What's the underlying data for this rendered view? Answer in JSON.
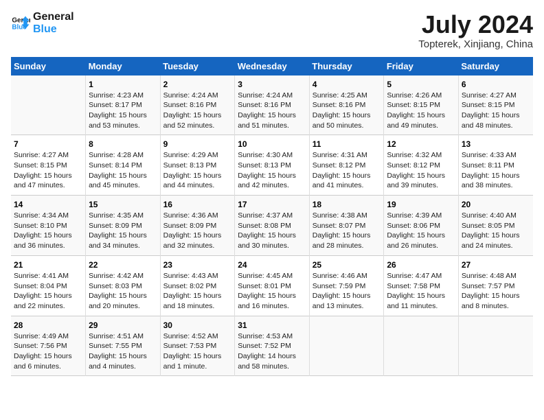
{
  "header": {
    "logo_line1": "General",
    "logo_line2": "Blue",
    "month_year": "July 2024",
    "location": "Topterek, Xinjiang, China"
  },
  "days_of_week": [
    "Sunday",
    "Monday",
    "Tuesday",
    "Wednesday",
    "Thursday",
    "Friday",
    "Saturday"
  ],
  "weeks": [
    [
      {
        "day": "",
        "text": ""
      },
      {
        "day": "1",
        "text": "Sunrise: 4:23 AM\nSunset: 8:17 PM\nDaylight: 15 hours\nand 53 minutes."
      },
      {
        "day": "2",
        "text": "Sunrise: 4:24 AM\nSunset: 8:16 PM\nDaylight: 15 hours\nand 52 minutes."
      },
      {
        "day": "3",
        "text": "Sunrise: 4:24 AM\nSunset: 8:16 PM\nDaylight: 15 hours\nand 51 minutes."
      },
      {
        "day": "4",
        "text": "Sunrise: 4:25 AM\nSunset: 8:16 PM\nDaylight: 15 hours\nand 50 minutes."
      },
      {
        "day": "5",
        "text": "Sunrise: 4:26 AM\nSunset: 8:15 PM\nDaylight: 15 hours\nand 49 minutes."
      },
      {
        "day": "6",
        "text": "Sunrise: 4:27 AM\nSunset: 8:15 PM\nDaylight: 15 hours\nand 48 minutes."
      }
    ],
    [
      {
        "day": "7",
        "text": "Sunrise: 4:27 AM\nSunset: 8:15 PM\nDaylight: 15 hours\nand 47 minutes."
      },
      {
        "day": "8",
        "text": "Sunrise: 4:28 AM\nSunset: 8:14 PM\nDaylight: 15 hours\nand 45 minutes."
      },
      {
        "day": "9",
        "text": "Sunrise: 4:29 AM\nSunset: 8:13 PM\nDaylight: 15 hours\nand 44 minutes."
      },
      {
        "day": "10",
        "text": "Sunrise: 4:30 AM\nSunset: 8:13 PM\nDaylight: 15 hours\nand 42 minutes."
      },
      {
        "day": "11",
        "text": "Sunrise: 4:31 AM\nSunset: 8:12 PM\nDaylight: 15 hours\nand 41 minutes."
      },
      {
        "day": "12",
        "text": "Sunrise: 4:32 AM\nSunset: 8:12 PM\nDaylight: 15 hours\nand 39 minutes."
      },
      {
        "day": "13",
        "text": "Sunrise: 4:33 AM\nSunset: 8:11 PM\nDaylight: 15 hours\nand 38 minutes."
      }
    ],
    [
      {
        "day": "14",
        "text": "Sunrise: 4:34 AM\nSunset: 8:10 PM\nDaylight: 15 hours\nand 36 minutes."
      },
      {
        "day": "15",
        "text": "Sunrise: 4:35 AM\nSunset: 8:09 PM\nDaylight: 15 hours\nand 34 minutes."
      },
      {
        "day": "16",
        "text": "Sunrise: 4:36 AM\nSunset: 8:09 PM\nDaylight: 15 hours\nand 32 minutes."
      },
      {
        "day": "17",
        "text": "Sunrise: 4:37 AM\nSunset: 8:08 PM\nDaylight: 15 hours\nand 30 minutes."
      },
      {
        "day": "18",
        "text": "Sunrise: 4:38 AM\nSunset: 8:07 PM\nDaylight: 15 hours\nand 28 minutes."
      },
      {
        "day": "19",
        "text": "Sunrise: 4:39 AM\nSunset: 8:06 PM\nDaylight: 15 hours\nand 26 minutes."
      },
      {
        "day": "20",
        "text": "Sunrise: 4:40 AM\nSunset: 8:05 PM\nDaylight: 15 hours\nand 24 minutes."
      }
    ],
    [
      {
        "day": "21",
        "text": "Sunrise: 4:41 AM\nSunset: 8:04 PM\nDaylight: 15 hours\nand 22 minutes."
      },
      {
        "day": "22",
        "text": "Sunrise: 4:42 AM\nSunset: 8:03 PM\nDaylight: 15 hours\nand 20 minutes."
      },
      {
        "day": "23",
        "text": "Sunrise: 4:43 AM\nSunset: 8:02 PM\nDaylight: 15 hours\nand 18 minutes."
      },
      {
        "day": "24",
        "text": "Sunrise: 4:45 AM\nSunset: 8:01 PM\nDaylight: 15 hours\nand 16 minutes."
      },
      {
        "day": "25",
        "text": "Sunrise: 4:46 AM\nSunset: 7:59 PM\nDaylight: 15 hours\nand 13 minutes."
      },
      {
        "day": "26",
        "text": "Sunrise: 4:47 AM\nSunset: 7:58 PM\nDaylight: 15 hours\nand 11 minutes."
      },
      {
        "day": "27",
        "text": "Sunrise: 4:48 AM\nSunset: 7:57 PM\nDaylight: 15 hours\nand 8 minutes."
      }
    ],
    [
      {
        "day": "28",
        "text": "Sunrise: 4:49 AM\nSunset: 7:56 PM\nDaylight: 15 hours\nand 6 minutes."
      },
      {
        "day": "29",
        "text": "Sunrise: 4:51 AM\nSunset: 7:55 PM\nDaylight: 15 hours\nand 4 minutes."
      },
      {
        "day": "30",
        "text": "Sunrise: 4:52 AM\nSunset: 7:53 PM\nDaylight: 15 hours\nand 1 minute."
      },
      {
        "day": "31",
        "text": "Sunrise: 4:53 AM\nSunset: 7:52 PM\nDaylight: 14 hours\nand 58 minutes."
      },
      {
        "day": "",
        "text": ""
      },
      {
        "day": "",
        "text": ""
      },
      {
        "day": "",
        "text": ""
      }
    ]
  ]
}
